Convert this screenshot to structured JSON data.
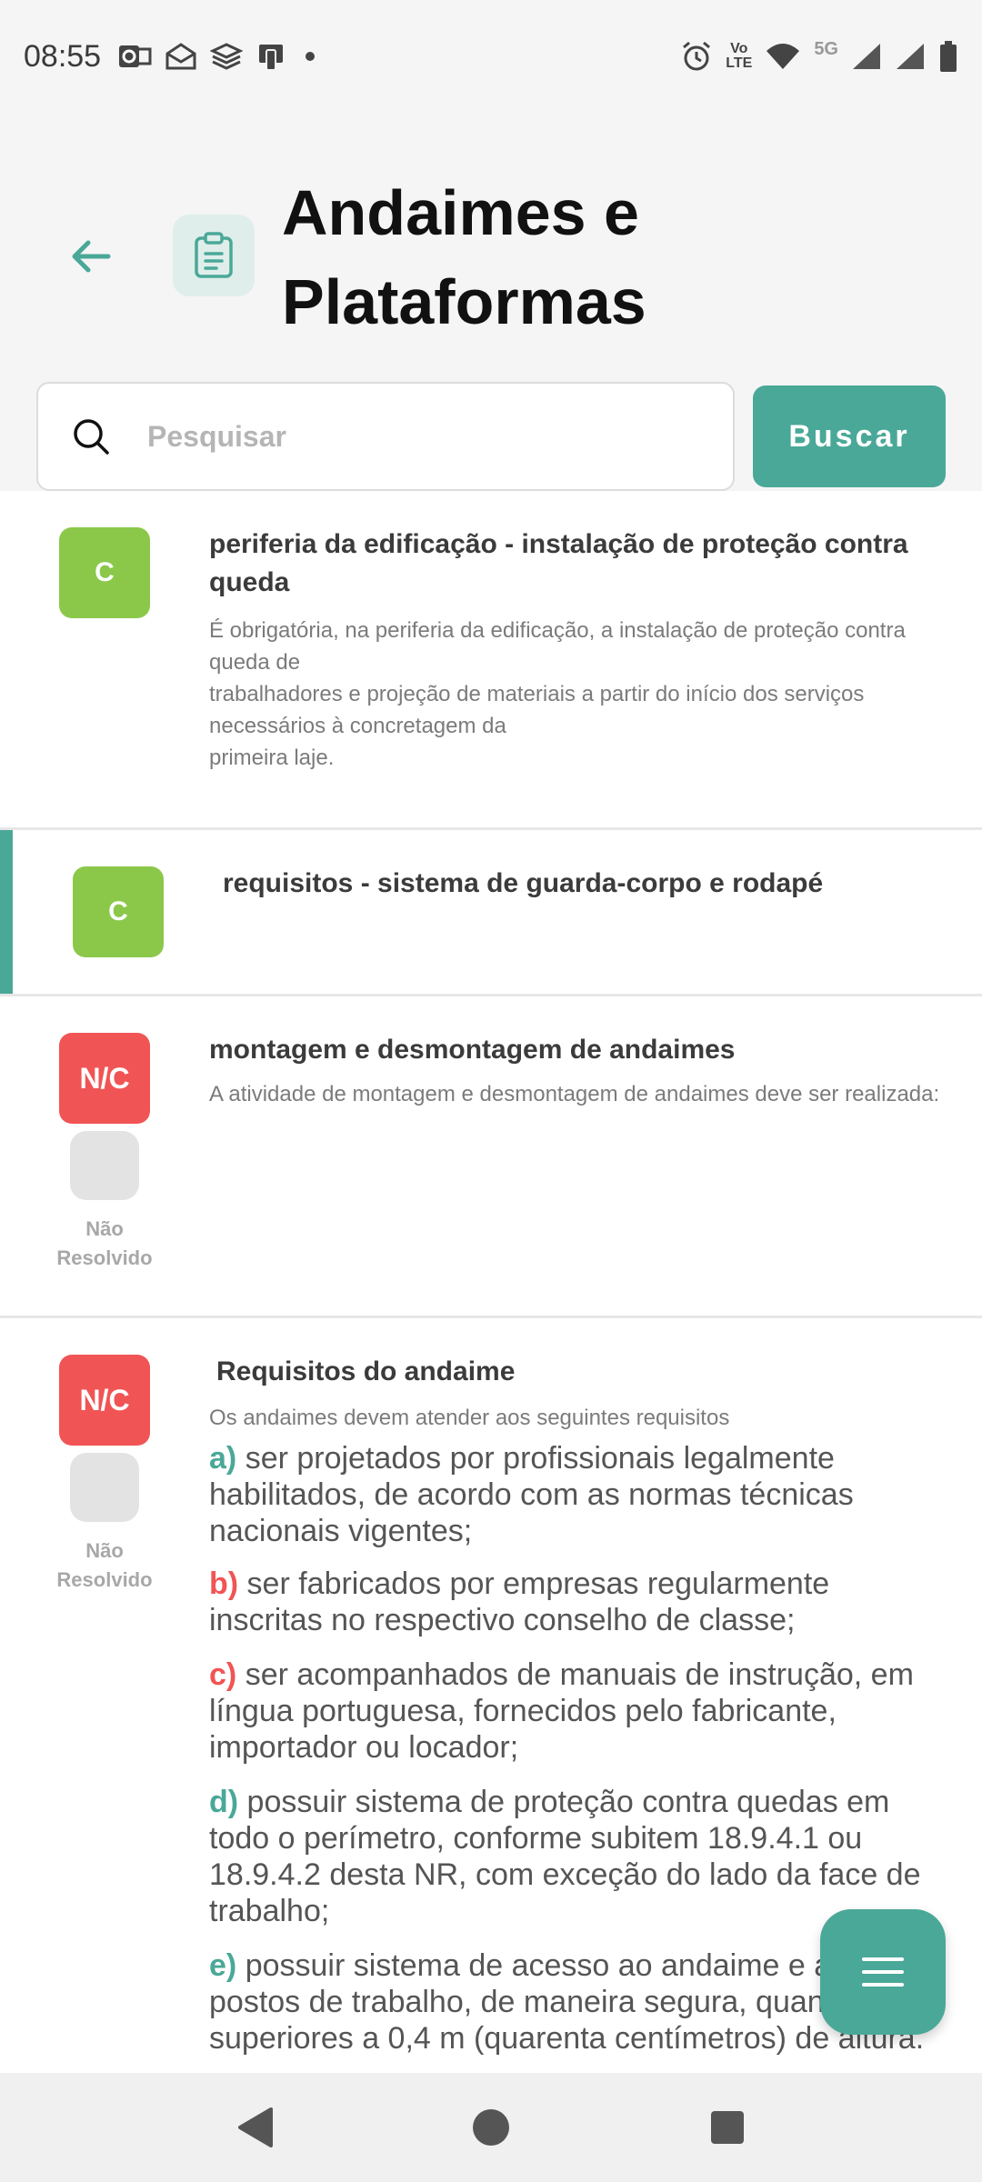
{
  "status_bar": {
    "time": "08:55",
    "volte_top": "Vo",
    "volte_bottom": "LTE",
    "network": "5G"
  },
  "header": {
    "title": "Andaimes e Plataformas"
  },
  "search": {
    "placeholder": "Pesquisar",
    "button_label": "Buscar"
  },
  "items": [
    {
      "badge": "C",
      "title": "periferia da edificação - instalação de proteção contra queda",
      "description": "É obrigatória, na periferia da edificação, a instalação de proteção contra queda de\ntrabalhadores e projeção de materiais a partir do início dos serviços necessários à concretagem da\nprimeira laje."
    },
    {
      "badge": "C",
      "title": "requisitos - sistema de guarda-corpo e rodapé"
    },
    {
      "badge": "N/C",
      "title": "montagem e desmontagem de andaimes",
      "description": "A atividade de montagem e desmontagem de andaimes deve ser realizada:",
      "resolve_label": "Não Resolvido"
    },
    {
      "badge": "N/C",
      "title": "Requisitos do andaime",
      "description": "Os andaimes devem atender aos seguintes requisitos",
      "resolve_label": "Não Resolvido",
      "requirements": [
        {
          "letter": "a)",
          "text": "ser projetados por profissionais legalmente habilitados, de acordo com as normas técnicas nacionais vigentes;"
        },
        {
          "letter": "b)",
          "text": "ser fabricados por empresas regularmente inscritas no respectivo conselho de classe;"
        },
        {
          "letter": "c)",
          "text": "ser acompanhados de manuais de instrução, em língua portuguesa, fornecidos pelo fabricante, importador ou locador;"
        },
        {
          "letter": "d)",
          "text": "possuir sistema de proteção contra quedas em todo o perímetro, conforme subitem 18.9.4.1 ou 18.9.4.2 desta NR, com exceção do lado da face de trabalho;"
        },
        {
          "letter": "e)",
          "text": "possuir sistema de acesso ao andaime e aos postos de trabalho, de maneira segura, quando superiores a 0,4 m (quarenta centímetros) de altura."
        }
      ]
    }
  ],
  "colors": {
    "accent": "#4aa898",
    "conform": "#8bc84a",
    "nonconform": "#f15454"
  }
}
